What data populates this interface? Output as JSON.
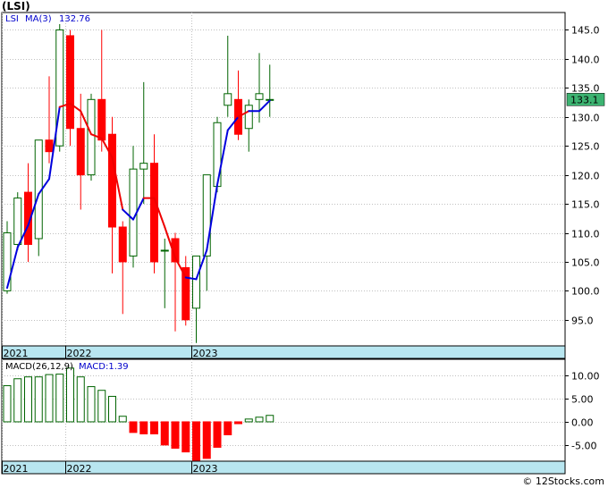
{
  "title": "(LSI)",
  "credit": "© 12Stocks.com",
  "chart_data": [
    {
      "type": "candlestick",
      "legend": {
        "symbol": "LSI",
        "ma_label": "MA(3)",
        "ma_value": "132.76"
      },
      "price_tag": "133.1",
      "ylim": [
        90.5,
        148
      ],
      "yticks": [
        95,
        100,
        105,
        110,
        115,
        120,
        125,
        130,
        135,
        140,
        145
      ],
      "ytick_labels": [
        "95.0",
        "100.0",
        "105.0",
        "110.0",
        "115.0",
        "120.0",
        "125.0",
        "130.0",
        "135.0",
        "140.0",
        "145.0"
      ],
      "x_labels": [
        {
          "label": "2021",
          "index": 0
        },
        {
          "label": "2022",
          "index": 6
        },
        {
          "label": "2023",
          "index": 18
        }
      ],
      "candles": [
        {
          "o": 100,
          "h": 112,
          "l": 99.5,
          "c": 110
        },
        {
          "o": 108,
          "h": 117,
          "l": 107,
          "c": 116
        },
        {
          "o": 117,
          "h": 122,
          "l": 105,
          "c": 108
        },
        {
          "o": 109,
          "h": 126,
          "l": 106,
          "c": 126
        },
        {
          "o": 126,
          "h": 137,
          "l": 122,
          "c": 124
        },
        {
          "o": 125,
          "h": 146,
          "l": 124,
          "c": 145
        },
        {
          "o": 144,
          "h": 145,
          "l": 125,
          "c": 128
        },
        {
          "o": 128,
          "h": 134,
          "l": 114,
          "c": 120
        },
        {
          "o": 120,
          "h": 134,
          "l": 119,
          "c": 133
        },
        {
          "o": 133,
          "h": 145,
          "l": 124,
          "c": 126
        },
        {
          "o": 127,
          "h": 130,
          "l": 103,
          "c": 111
        },
        {
          "o": 111,
          "h": 112,
          "l": 96,
          "c": 105
        },
        {
          "o": 106,
          "h": 125,
          "l": 104,
          "c": 121
        },
        {
          "o": 121,
          "h": 136,
          "l": 115,
          "c": 122
        },
        {
          "o": 122,
          "h": 127,
          "l": 103,
          "c": 105
        },
        {
          "o": 107,
          "h": 109,
          "l": 97,
          "c": 107
        },
        {
          "o": 109,
          "h": 110,
          "l": 93,
          "c": 105
        },
        {
          "o": 104,
          "h": 106,
          "l": 94,
          "c": 95
        },
        {
          "o": 97,
          "h": 106,
          "l": 91,
          "c": 106
        },
        {
          "o": 106,
          "h": 120,
          "l": 100,
          "c": 120
        },
        {
          "o": 118,
          "h": 130,
          "l": 117,
          "c": 129
        },
        {
          "o": 132,
          "h": 144,
          "l": 130,
          "c": 134
        },
        {
          "o": 133,
          "h": 138,
          "l": 126,
          "c": 127
        },
        {
          "o": 128,
          "h": 133,
          "l": 124,
          "c": 132
        },
        {
          "o": 133,
          "h": 141,
          "l": 129,
          "c": 134
        },
        {
          "o": 133,
          "h": 139,
          "l": 130,
          "c": 133
        }
      ],
      "ma": [
        100.5,
        107.5,
        111.3,
        116.7,
        119.3,
        131.7,
        132.3,
        131.0,
        127.0,
        126.3,
        123.0,
        114.0,
        112.3,
        116.0,
        116.0,
        111.0,
        105.7,
        102.3,
        102.0,
        107.0,
        118.3,
        127.7,
        130.0,
        131.0,
        131.0,
        132.8
      ],
      "ma_colors": [
        "blue",
        "blue",
        "blue",
        "blue",
        "blue",
        "blue",
        "red",
        "red",
        "red",
        "red",
        "red",
        "red",
        "blue",
        "blue",
        "red",
        "red",
        "red",
        "red",
        "blue",
        "blue",
        "blue",
        "blue",
        "blue",
        "red",
        "blue",
        "blue"
      ]
    },
    {
      "type": "bar",
      "legend": {
        "name": "MACD(26,12,9)",
        "value_label": "MACD:1.39"
      },
      "ylim": [
        -8.5,
        13.5
      ],
      "yticks": [
        -5,
        0,
        5,
        10
      ],
      "ytick_labels": [
        "-5.00",
        "0.00",
        "5.00",
        "10.00"
      ],
      "x_labels": [
        {
          "label": "2021",
          "index": 0
        },
        {
          "label": "2022",
          "index": 6
        },
        {
          "label": "2023",
          "index": 18
        }
      ],
      "values": [
        7.8,
        9.3,
        9.7,
        9.7,
        10.2,
        10.3,
        11.6,
        9.7,
        7.6,
        6.8,
        5.5,
        1.2,
        -2.3,
        -2.6,
        -2.6,
        -5.0,
        -5.7,
        -6.5,
        -8.3,
        -7.9,
        -5.5,
        -2.8,
        -0.4,
        0.6,
        1.0,
        1.39
      ]
    }
  ],
  "colors": {
    "up": "#006400",
    "down": "#ff0000",
    "ma_up": "#0000dd",
    "ma_down": "#ee0000",
    "grid": "#c0c0c0",
    "axis_band": "#b8e6f0",
    "price_tag_bg": "#3cb371"
  }
}
